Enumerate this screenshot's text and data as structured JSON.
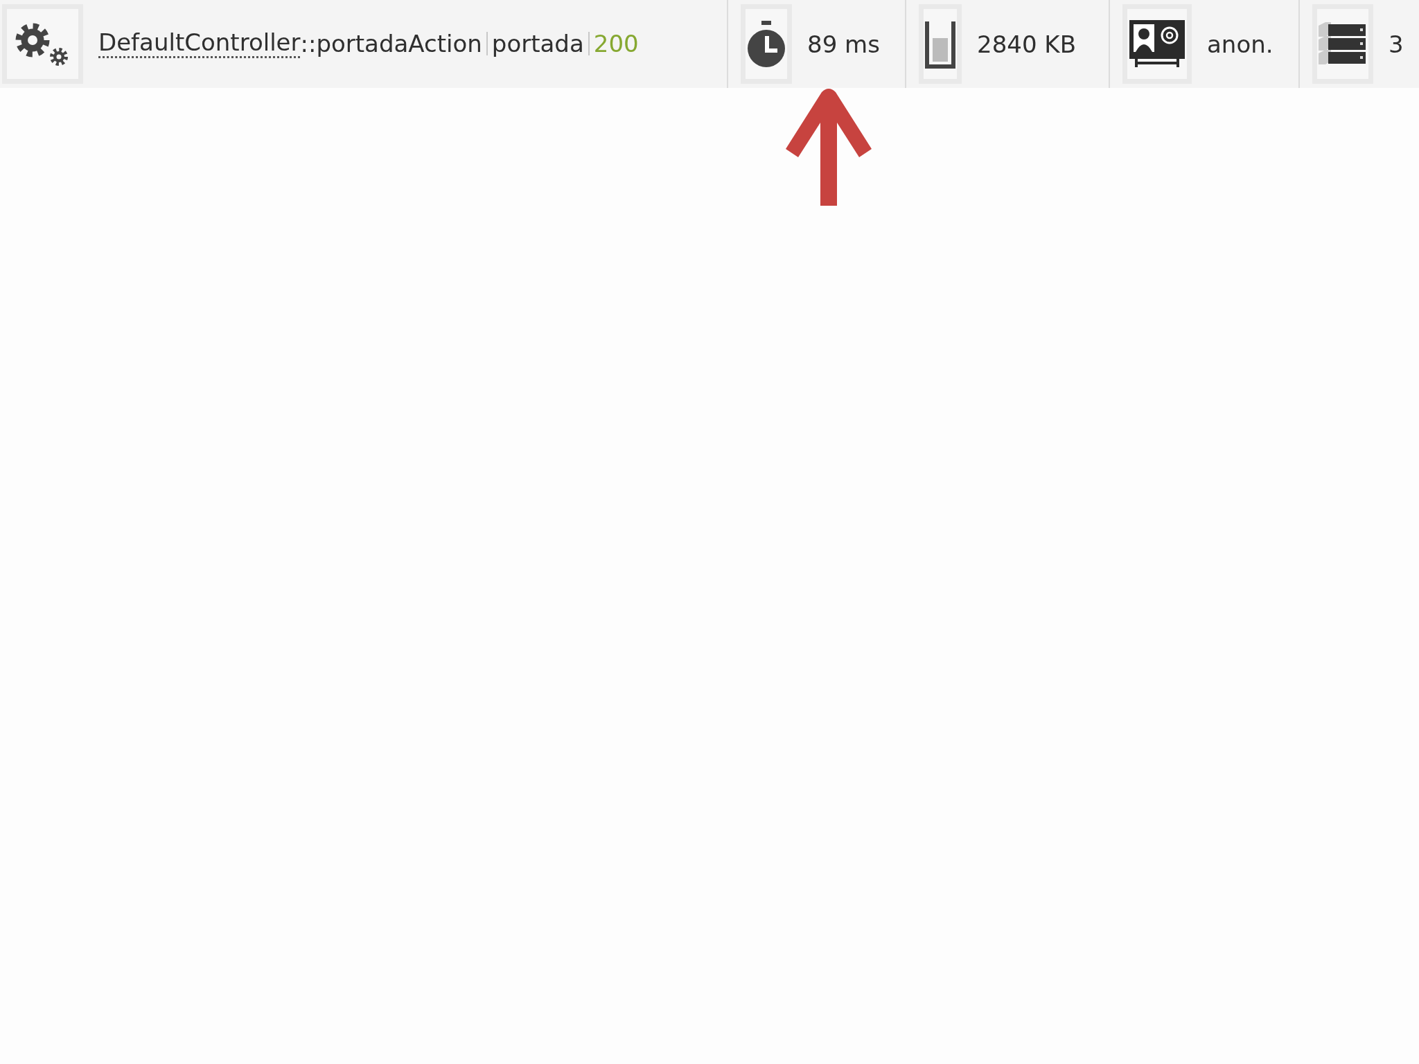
{
  "toolbar": {
    "request": {
      "controller": "DefaultController",
      "action": "::portadaAction",
      "route": "portada",
      "status": "200"
    },
    "panels": [
      {
        "kind": "time",
        "value": "89 ms"
      },
      {
        "kind": "memory",
        "value": "2840 KB"
      },
      {
        "kind": "user",
        "value": "anon."
      },
      {
        "kind": "database",
        "value": "3"
      }
    ]
  },
  "annotation": {
    "kind": "arrow"
  }
}
